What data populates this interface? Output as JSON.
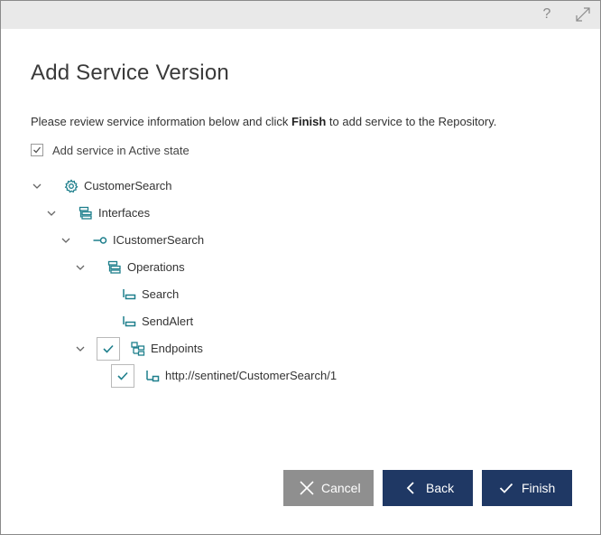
{
  "titlebar": {
    "help_label": "?",
    "expand_icon": "expand-icon"
  },
  "dialog": {
    "title": "Add Service Version",
    "description_prefix": "Please review service information below and click ",
    "description_bold": "Finish",
    "description_suffix": " to add service to the Repository.",
    "active_state_label": "Add service in Active state",
    "active_state_checked": true
  },
  "tree": {
    "service": {
      "label": "CustomerSearch",
      "icon": "gear-icon"
    },
    "interfaces": {
      "label": "Interfaces",
      "icon": "folder-stack-icon"
    },
    "interface": {
      "label": "ICustomerSearch",
      "icon": "interface-lollipop-icon"
    },
    "operations": {
      "label": "Operations",
      "icon": "folder-stack-icon"
    },
    "op_search": {
      "label": "Search",
      "icon": "operation-icon"
    },
    "op_sendalert": {
      "label": "SendAlert",
      "icon": "operation-icon"
    },
    "endpoints": {
      "label": "Endpoints",
      "icon": "endpoints-icon",
      "checked": true
    },
    "endpoint": {
      "label": "http://sentinet/CustomerSearch/1",
      "icon": "endpoint-icon",
      "checked": true
    }
  },
  "buttons": {
    "cancel": "Cancel",
    "back": "Back",
    "finish": "Finish"
  },
  "colors": {
    "primary_button": "#1f3864",
    "disabled_button": "#8f8f8f",
    "icon_teal": "#1e7f8c",
    "titlebar": "#e9e9e9"
  }
}
